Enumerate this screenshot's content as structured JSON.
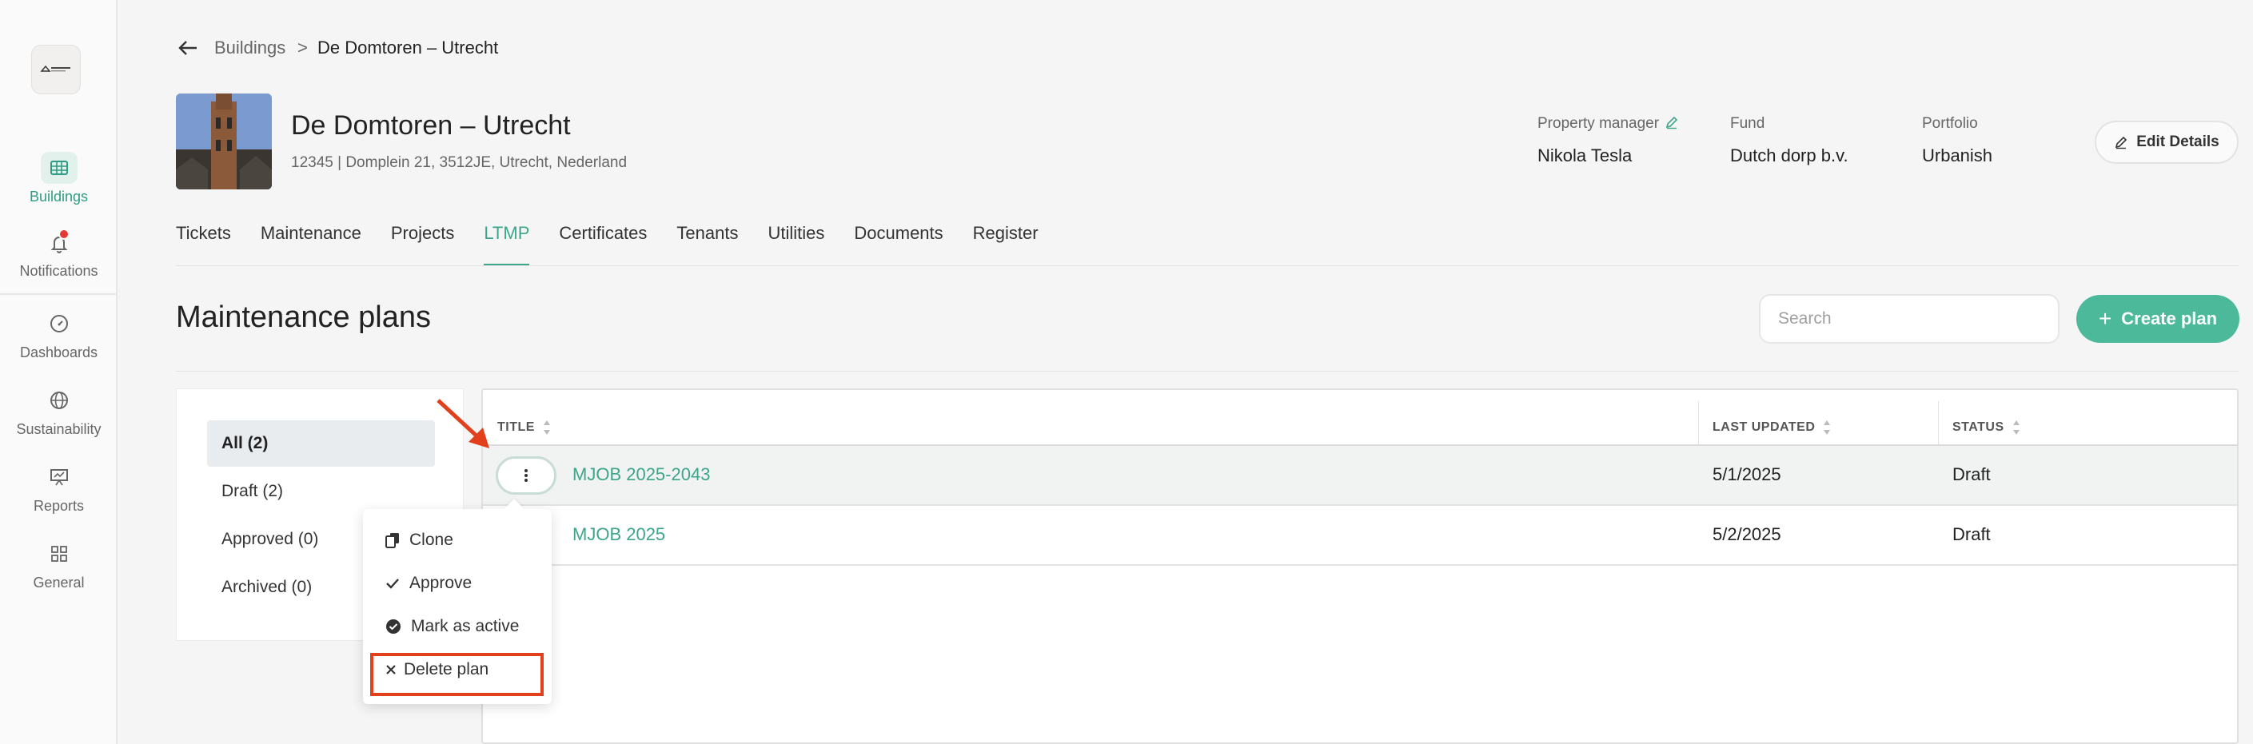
{
  "sidebar": {
    "items": [
      {
        "label": "Buildings",
        "icon": "table-icon",
        "active": true
      },
      {
        "label": "Notifications",
        "icon": "bell-icon",
        "active": false
      },
      {
        "label": "Dashboards",
        "icon": "gauge-icon",
        "active": false
      },
      {
        "label": "Sustainability",
        "icon": "globe-icon",
        "active": false
      },
      {
        "label": "Reports",
        "icon": "presentation-icon",
        "active": false
      },
      {
        "label": "General",
        "icon": "grid-icon",
        "active": false
      }
    ]
  },
  "breadcrumb": {
    "parent": "Buildings",
    "separator": ">",
    "current": "De Domtoren – Utrecht"
  },
  "building": {
    "title": "De Domtoren – Utrecht",
    "subtitle": "12345 | Domplein 21, 3512JE, Utrecht, Nederland"
  },
  "meta": {
    "property_manager_label": "Property manager",
    "property_manager": "Nikola Tesla",
    "fund_label": "Fund",
    "fund": "Dutch dorp b.v.",
    "portfolio_label": "Portfolio",
    "portfolio": "Urbanish"
  },
  "edit_details_label": "Edit Details",
  "tabs": [
    "Tickets",
    "Maintenance",
    "Projects",
    "LTMP",
    "Certificates",
    "Tenants",
    "Utilities",
    "Documents",
    "Register"
  ],
  "active_tab": "LTMP",
  "page_title": "Maintenance plans",
  "search": {
    "placeholder": "Search"
  },
  "create_label": "Create plan",
  "filters": [
    "All (2)",
    "Draft (2)",
    "Approved (0)",
    "Archived (0)"
  ],
  "table": {
    "headers": {
      "title": "TITLE",
      "last_updated": "LAST UPDATED",
      "status": "STATUS"
    },
    "rows": [
      {
        "title": "MJOB 2025-2043",
        "last_updated": "5/1/2025",
        "status": "Draft"
      },
      {
        "title": "MJOB 2025",
        "last_updated": "5/2/2025",
        "status": "Draft"
      }
    ]
  },
  "menu": {
    "items": [
      {
        "label": "Clone",
        "icon": "copy-icon"
      },
      {
        "label": "Approve",
        "icon": "check-icon"
      },
      {
        "label": "Mark as active",
        "icon": "check-circle-icon"
      },
      {
        "label": "Delete plan",
        "icon": "x-icon"
      }
    ]
  },
  "colors": {
    "accent": "#3da58a",
    "button": "#4cb99a",
    "highlight": "#e2401c"
  }
}
